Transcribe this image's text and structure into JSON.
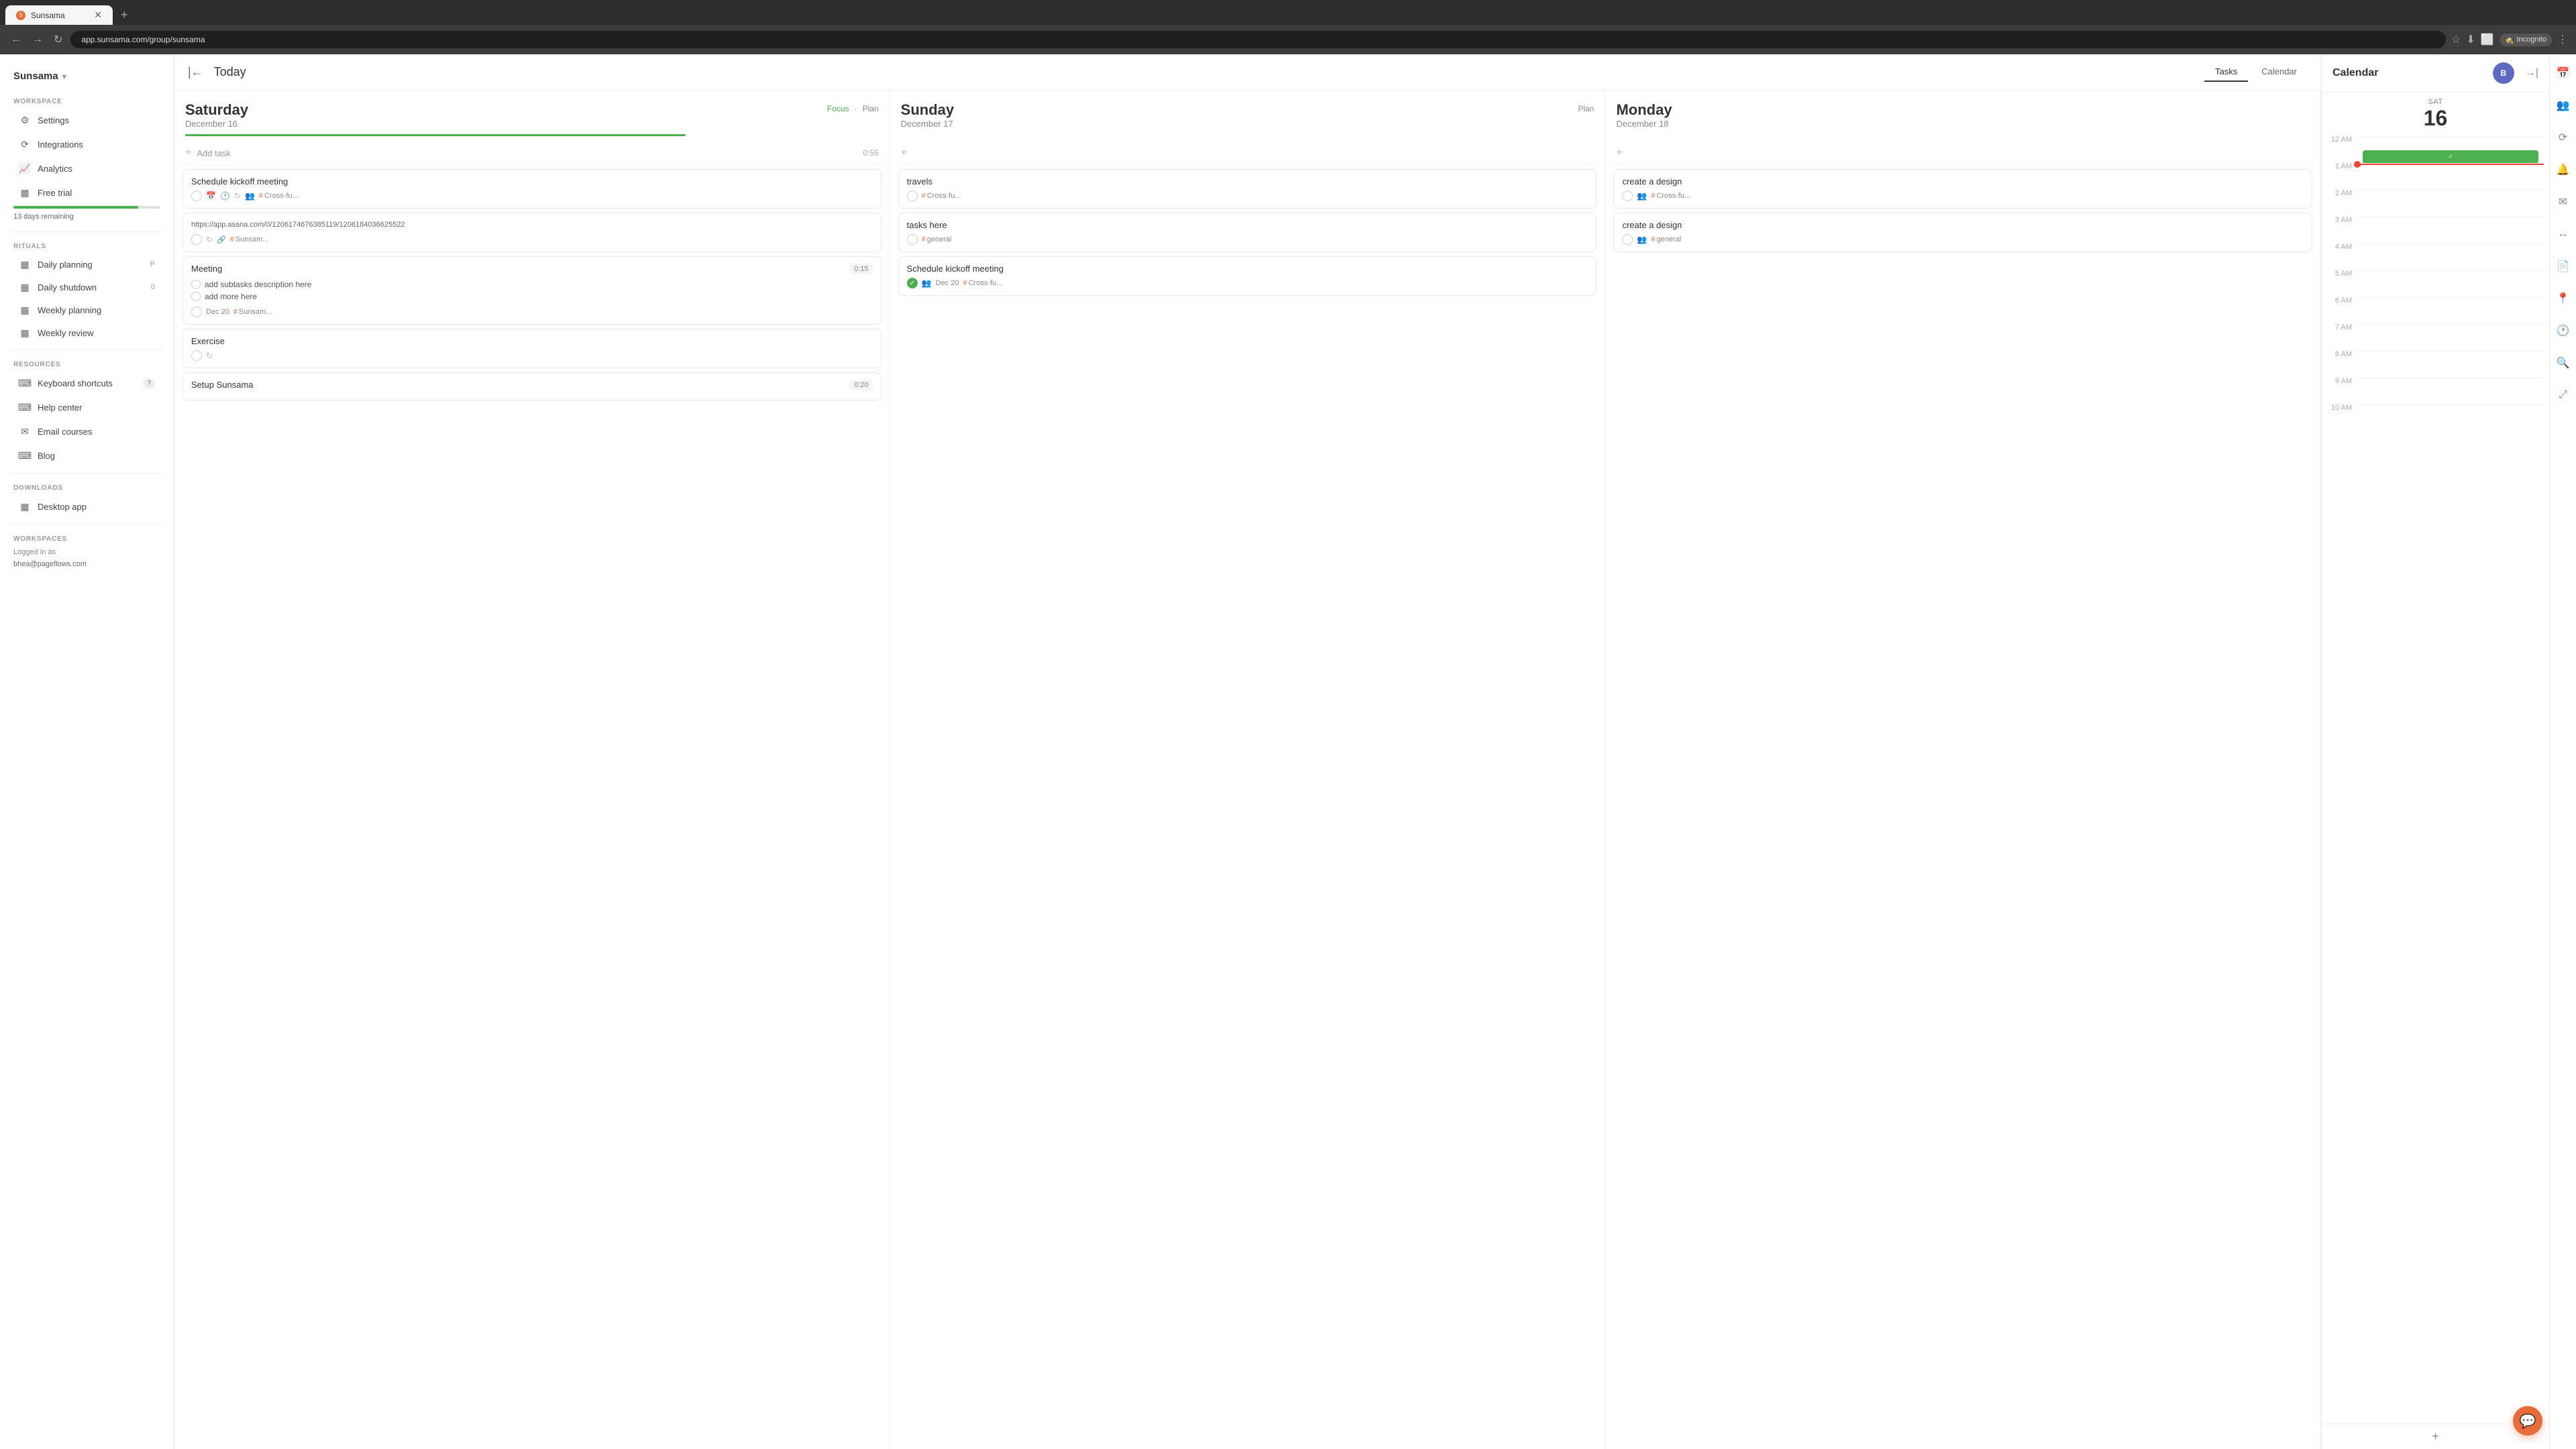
{
  "browser": {
    "tab_title": "Sunsama",
    "tab_favicon": "S",
    "address": "app.sunsama.com/group/sunsama",
    "incognito_label": "Incognito"
  },
  "sidebar": {
    "brand": "Sunsama",
    "workspace_label": "WORKSPACE",
    "settings_label": "Settings",
    "integrations_label": "Integrations",
    "analytics_label": "Analytics",
    "free_trial_label": "Free trial",
    "trial_days_label": "13 days remaining",
    "rituals_label": "RITUALS",
    "daily_planning_label": "Daily planning",
    "daily_planning_shortcut": "P",
    "daily_shutdown_label": "Daily shutdown",
    "daily_shutdown_shortcut": "0",
    "weekly_planning_label": "Weekly planning",
    "weekly_review_label": "Weekly review",
    "resources_label": "RESOURCES",
    "keyboard_shortcuts_label": "Keyboard shortcuts",
    "help_center_label": "Help center",
    "email_courses_label": "Email courses",
    "blog_label": "Blog",
    "downloads_label": "DOWNLOADS",
    "desktop_app_label": "Desktop app",
    "workspaces_label": "WORKSPACES",
    "logged_in_label": "Logged in as",
    "user_email": "bhea@pageflows.com"
  },
  "main": {
    "header": {
      "today_label": "Today",
      "tasks_tab": "Tasks",
      "calendar_tab": "Calendar"
    },
    "saturday": {
      "day_name": "Saturday",
      "date": "December 16",
      "action1": "Focus",
      "action2": "Plan",
      "add_task_placeholder": "Add task",
      "add_task_time": "0:55",
      "tasks": [
        {
          "title": "Schedule kickoff meeting",
          "icons": [
            "check",
            "calendar",
            "clock",
            "repeat",
            "people"
          ],
          "tag": "Cross-fu..."
        },
        {
          "title": "https://app.asana.com/0/1206174676385119/1206184036625522",
          "icons": [
            "check",
            "repeat",
            "link"
          ],
          "tag": "Sunsam..."
        },
        {
          "title": "Meeting",
          "time": "0:15",
          "subtasks": [
            "add subtasks description here",
            "add more here"
          ],
          "date": "Dec 20",
          "tag": "Sunsam..."
        },
        {
          "title": "Exercise",
          "icons": [
            "check",
            "repeat"
          ]
        },
        {
          "title": "Setup Sunsama",
          "time": "0:20"
        }
      ]
    },
    "sunday": {
      "day_name": "Sunday",
      "date": "December 17",
      "action1": "Plan",
      "tasks": [
        {
          "title": "travels",
          "icons": [
            "check"
          ],
          "tag": "Cross-fu..."
        },
        {
          "title": "tasks here",
          "icons": [
            "check"
          ],
          "tag": "general"
        },
        {
          "title": "Schedule kickoff meeting",
          "icons": [
            "check",
            "people"
          ],
          "date": "Dec 20",
          "tag": "Cross-fu..."
        }
      ]
    },
    "monday": {
      "day_name": "Monday",
      "date": "December 18",
      "tasks": [
        {
          "title": "create a design",
          "icons": [
            "check",
            "people"
          ],
          "tag": "Cross-fu..."
        },
        {
          "title": "create a design",
          "icons": [
            "check",
            "people"
          ],
          "tag": "general"
        }
      ]
    }
  },
  "calendar": {
    "title": "Calendar",
    "day_of_week": "SAT",
    "day_number": "16",
    "times": [
      "12 AM",
      "1 AM",
      "2 AM",
      "3 AM",
      "4 AM",
      "5 AM",
      "6 AM",
      "7 AM",
      "8 AM",
      "9 AM",
      "10 AM"
    ]
  },
  "chat": {
    "fab_icon": "💬"
  }
}
